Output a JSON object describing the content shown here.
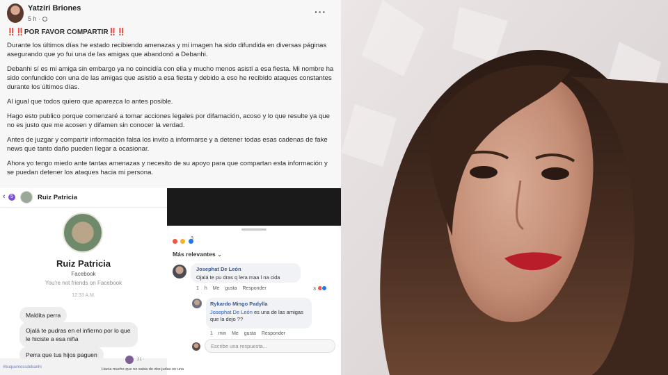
{
  "post": {
    "author": "Yatziri Briones",
    "time": "5 h ·",
    "headline_marks": "‼️‼️",
    "headline": "POR FAVOR COMPARTIR",
    "headline_end": "‼️‼️",
    "paragraphs": [
      "Durante los últimos días he estado recibiendo amenazas y mi imagen ha sido difundida en diversas páginas asegurando que yo fui una de las amigas que abandonó a Debanhi.",
      "Debanhi sí es mi amiga sin embargo ya no coincidía con ella y mucho menos asistí a esa fiesta. Mi nombre ha sido confundido con una de las amigas que asistió a esa fiesta y debido a eso he recibido ataques constantes durante los últimos días.",
      "Al igual que todos quiero que aparezca lo antes posible.",
      "Hago esto publico porque comenzaré a tomar acciones legales por difamación, acoso y lo que resulte ya que no es justo que me acosen y difamen sin conocer la verdad.",
      "Antes de juzgar y compartir información falsa los invito a informarse y a detener todas esas cadenas de fake news que tanto daño pueden llegar a ocasionar.",
      "Ahora yo tengo miedo ante tantas amenazas y necesito de su apoyo para que compartan esta información y se puedan detener los ataques hacia mi persona."
    ],
    "menu_icon": "more-horizontal-icon"
  },
  "messenger": {
    "back_count": "5",
    "top_name": "Ruiz Patricia",
    "profile_name": "Ruiz Patricia",
    "profile_sub": "Facebook",
    "profile_note": "You're not friends on Facebook",
    "time": "12:33 A.M.",
    "messages": [
      "Maldita perra",
      "Ojalá te pudras en el infierno por lo que le hiciste a esa niña",
      "Perra que tus hijos paguen"
    ],
    "bottom_caption": "#buquemossdebanhi"
  },
  "comments": {
    "filter": "Más relevantes",
    "reaction_count": "3",
    "comment1": {
      "name": "Josephat De León",
      "text": "Ojalá te pu dras q lera maa l na cida",
      "meta_time": "1 h",
      "like": "Me gusta",
      "reply": "Responder",
      "react_count": "3"
    },
    "comment2": {
      "name": "Rykardo Mingo Padylla",
      "mention": "Josephat De León",
      "text": " es una de las amigas que la dejo ??",
      "meta_time": "1 min",
      "like": "Me gusta",
      "reply": "Responder"
    },
    "reply_placeholder": "Escribe una respuesta...",
    "bottom_caption": "Hacia mucho que no sabia de dos judas en una",
    "bottom_meta": "21 ·"
  },
  "colors": {
    "facebook_blue": "#1877f2",
    "mention_blue": "#2a62c9",
    "alert_red": "#e0251b",
    "messenger_purple": "#7b4fd8"
  }
}
